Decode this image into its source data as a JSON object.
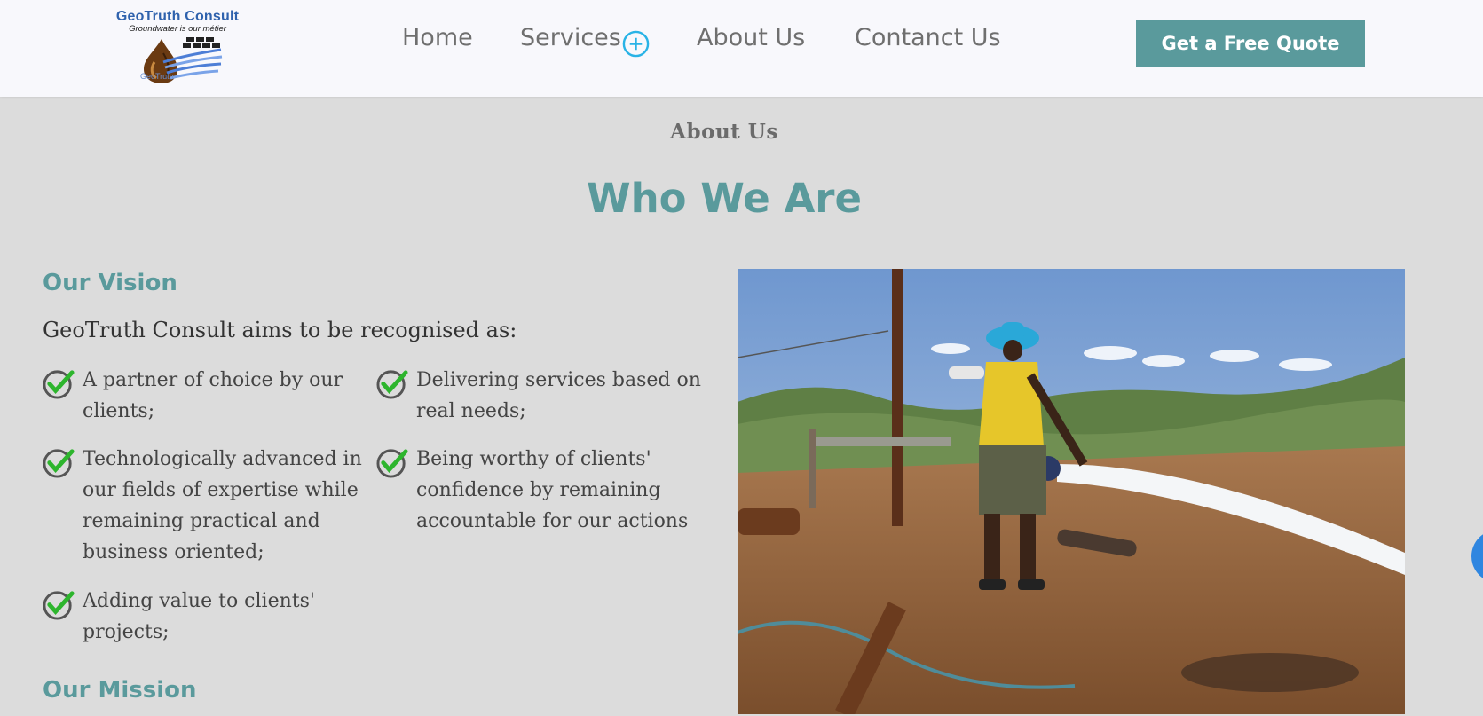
{
  "header": {
    "logo": {
      "title": "GeoTruth Consult",
      "tagline": "Groundwater is our métier",
      "small_text": "GeoTruth"
    },
    "nav": [
      {
        "label": "Home"
      },
      {
        "label": "Services",
        "icon": "plus-circle-icon"
      },
      {
        "label": "About Us"
      },
      {
        "label": "Contanct Us"
      }
    ],
    "cta_label": "Get a Free Quote"
  },
  "main": {
    "eyebrow": "About Us",
    "heading": "Who We Are",
    "vision": {
      "title": "Our Vision",
      "intro": "GeoTruth Consult aims to be recognised as:",
      "bullets": [
        {
          "lines": [
            "A partner of choice by our",
            "clients;"
          ]
        },
        {
          "lines": [
            "Delivering services based on",
            "real needs;"
          ]
        },
        {
          "lines": [
            "Technologically advanced in",
            "our fields of expertise while",
            "remaining practical and",
            "business oriented;"
          ]
        },
        {
          "lines": [
            "Being worthy of clients'",
            "confidence by remaining",
            "accountable for our actions"
          ]
        },
        {
          "lines": [
            "Adding value to clients'",
            "projects;"
          ]
        }
      ]
    },
    "mission": {
      "title": "Our Mission"
    },
    "photo": {
      "alt": "Worker in blue hat and yellow vest beside a pumping borehole discharging water"
    }
  },
  "colors": {
    "accent": "#5a9a9c",
    "header_bg": "#f8f8fc",
    "page_bg": "#dcdcdc",
    "check_green": "#2db52d",
    "services_icon": "#29b3e6"
  }
}
